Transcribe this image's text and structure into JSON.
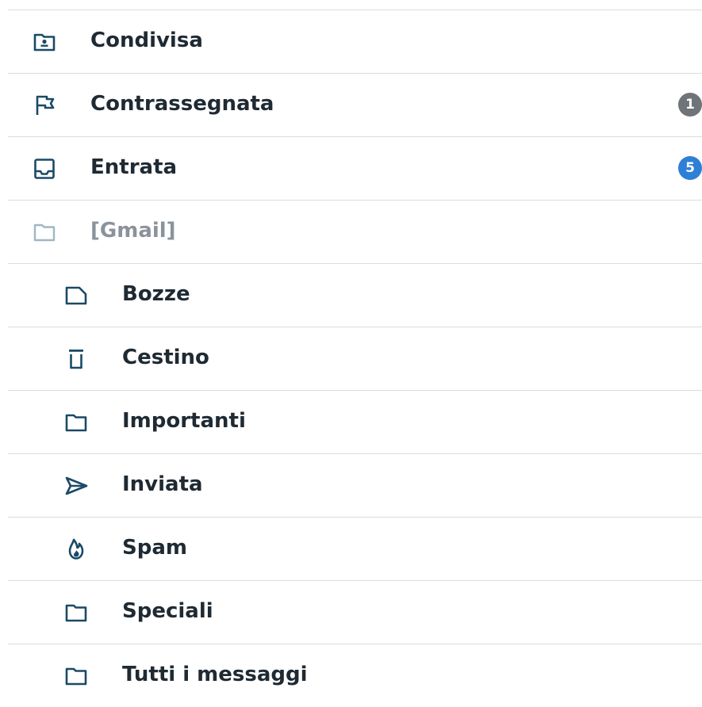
{
  "colors": {
    "icon": "#1b4a66",
    "icon_muted": "#9fb7c4",
    "text": "#1f2a33",
    "text_muted": "#8a939b",
    "divider": "#dcdcdc",
    "badge_gray": "#6f747a",
    "badge_blue": "#2f7fd6"
  },
  "folders": [
    {
      "label": "Condivisa",
      "icon": "shared-folder-icon"
    },
    {
      "label": "Contrassegnata",
      "icon": "flag-icon",
      "badge": "1"
    },
    {
      "label": "Entrata",
      "icon": "inbox-icon",
      "badge": "5"
    },
    {
      "label": "[Gmail]",
      "icon": "folder-icon"
    },
    {
      "label": "Bozze",
      "icon": "draft-icon"
    },
    {
      "label": "Cestino",
      "icon": "trash-icon"
    },
    {
      "label": "Importanti",
      "icon": "folder-icon"
    },
    {
      "label": "Inviata",
      "icon": "send-icon"
    },
    {
      "label": "Spam",
      "icon": "spam-flame-icon"
    },
    {
      "label": "Speciali",
      "icon": "folder-icon"
    },
    {
      "label": "Tutti i messaggi",
      "icon": "folder-icon"
    }
  ]
}
